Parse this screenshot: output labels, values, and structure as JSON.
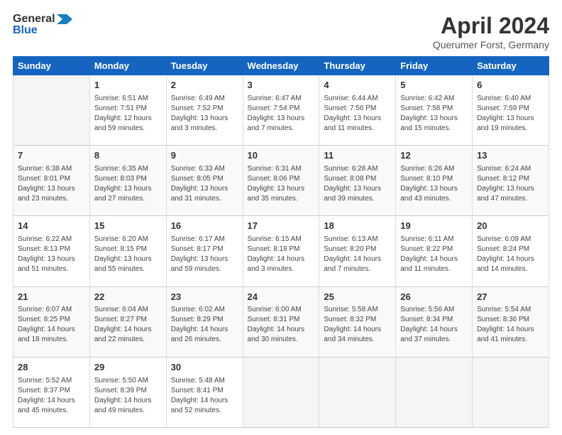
{
  "logo": {
    "general": "General",
    "blue": "Blue"
  },
  "title": "April 2024",
  "subtitle": "Querumer Forst, Germany",
  "days_header": [
    "Sunday",
    "Monday",
    "Tuesday",
    "Wednesday",
    "Thursday",
    "Friday",
    "Saturday"
  ],
  "weeks": [
    [
      {
        "day": "",
        "text": ""
      },
      {
        "day": "1",
        "text": "Sunrise: 6:51 AM\nSunset: 7:51 PM\nDaylight: 12 hours\nand 59 minutes."
      },
      {
        "day": "2",
        "text": "Sunrise: 6:49 AM\nSunset: 7:52 PM\nDaylight: 13 hours\nand 3 minutes."
      },
      {
        "day": "3",
        "text": "Sunrise: 6:47 AM\nSunset: 7:54 PM\nDaylight: 13 hours\nand 7 minutes."
      },
      {
        "day": "4",
        "text": "Sunrise: 6:44 AM\nSunset: 7:56 PM\nDaylight: 13 hours\nand 11 minutes."
      },
      {
        "day": "5",
        "text": "Sunrise: 6:42 AM\nSunset: 7:58 PM\nDaylight: 13 hours\nand 15 minutes."
      },
      {
        "day": "6",
        "text": "Sunrise: 6:40 AM\nSunset: 7:59 PM\nDaylight: 13 hours\nand 19 minutes."
      }
    ],
    [
      {
        "day": "7",
        "text": "Sunrise: 6:38 AM\nSunset: 8:01 PM\nDaylight: 13 hours\nand 23 minutes."
      },
      {
        "day": "8",
        "text": "Sunrise: 6:35 AM\nSunset: 8:03 PM\nDaylight: 13 hours\nand 27 minutes."
      },
      {
        "day": "9",
        "text": "Sunrise: 6:33 AM\nSunset: 8:05 PM\nDaylight: 13 hours\nand 31 minutes."
      },
      {
        "day": "10",
        "text": "Sunrise: 6:31 AM\nSunset: 8:06 PM\nDaylight: 13 hours\nand 35 minutes."
      },
      {
        "day": "11",
        "text": "Sunrise: 6:28 AM\nSunset: 8:08 PM\nDaylight: 13 hours\nand 39 minutes."
      },
      {
        "day": "12",
        "text": "Sunrise: 6:26 AM\nSunset: 8:10 PM\nDaylight: 13 hours\nand 43 minutes."
      },
      {
        "day": "13",
        "text": "Sunrise: 6:24 AM\nSunset: 8:12 PM\nDaylight: 13 hours\nand 47 minutes."
      }
    ],
    [
      {
        "day": "14",
        "text": "Sunrise: 6:22 AM\nSunset: 8:13 PM\nDaylight: 13 hours\nand 51 minutes."
      },
      {
        "day": "15",
        "text": "Sunrise: 6:20 AM\nSunset: 8:15 PM\nDaylight: 13 hours\nand 55 minutes."
      },
      {
        "day": "16",
        "text": "Sunrise: 6:17 AM\nSunset: 8:17 PM\nDaylight: 13 hours\nand 59 minutes."
      },
      {
        "day": "17",
        "text": "Sunrise: 6:15 AM\nSunset: 8:18 PM\nDaylight: 14 hours\nand 3 minutes."
      },
      {
        "day": "18",
        "text": "Sunrise: 6:13 AM\nSunset: 8:20 PM\nDaylight: 14 hours\nand 7 minutes."
      },
      {
        "day": "19",
        "text": "Sunrise: 6:11 AM\nSunset: 8:22 PM\nDaylight: 14 hours\nand 11 minutes."
      },
      {
        "day": "20",
        "text": "Sunrise: 6:09 AM\nSunset: 8:24 PM\nDaylight: 14 hours\nand 14 minutes."
      }
    ],
    [
      {
        "day": "21",
        "text": "Sunrise: 6:07 AM\nSunset: 8:25 PM\nDaylight: 14 hours\nand 18 minutes."
      },
      {
        "day": "22",
        "text": "Sunrise: 6:04 AM\nSunset: 8:27 PM\nDaylight: 14 hours\nand 22 minutes."
      },
      {
        "day": "23",
        "text": "Sunrise: 6:02 AM\nSunset: 8:29 PM\nDaylight: 14 hours\nand 26 minutes."
      },
      {
        "day": "24",
        "text": "Sunrise: 6:00 AM\nSunset: 8:31 PM\nDaylight: 14 hours\nand 30 minutes."
      },
      {
        "day": "25",
        "text": "Sunrise: 5:58 AM\nSunset: 8:32 PM\nDaylight: 14 hours\nand 34 minutes."
      },
      {
        "day": "26",
        "text": "Sunrise: 5:56 AM\nSunset: 8:34 PM\nDaylight: 14 hours\nand 37 minutes."
      },
      {
        "day": "27",
        "text": "Sunrise: 5:54 AM\nSunset: 8:36 PM\nDaylight: 14 hours\nand 41 minutes."
      }
    ],
    [
      {
        "day": "28",
        "text": "Sunrise: 5:52 AM\nSunset: 8:37 PM\nDaylight: 14 hours\nand 45 minutes."
      },
      {
        "day": "29",
        "text": "Sunrise: 5:50 AM\nSunset: 8:39 PM\nDaylight: 14 hours\nand 49 minutes."
      },
      {
        "day": "30",
        "text": "Sunrise: 5:48 AM\nSunset: 8:41 PM\nDaylight: 14 hours\nand 52 minutes."
      },
      {
        "day": "",
        "text": ""
      },
      {
        "day": "",
        "text": ""
      },
      {
        "day": "",
        "text": ""
      },
      {
        "day": "",
        "text": ""
      }
    ]
  ]
}
